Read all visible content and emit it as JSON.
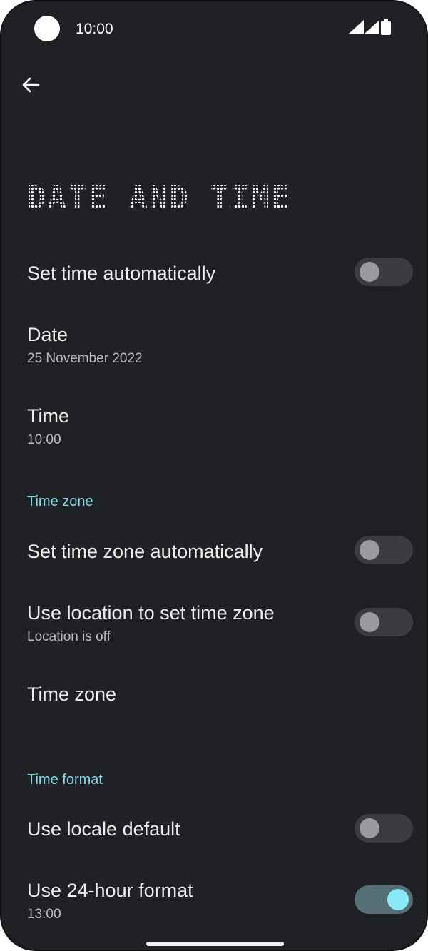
{
  "status_bar": {
    "time": "10:00"
  },
  "page": {
    "title": "DATE AND TIME"
  },
  "rows": {
    "set_time_auto": {
      "label": "Set time automatically",
      "toggle_on": false
    },
    "date": {
      "label": "Date",
      "value": "25 November 2022"
    },
    "time": {
      "label": "Time",
      "value": "10:00"
    },
    "set_zone_auto": {
      "label": "Set time zone automatically",
      "toggle_on": false
    },
    "use_location": {
      "label": "Use location to set time zone",
      "subtitle": "Location is off",
      "toggle_on": false
    },
    "time_zone": {
      "label": "Time zone"
    },
    "locale_default": {
      "label": "Use locale default",
      "toggle_on": false
    },
    "format_24h": {
      "label": "Use 24-hour format",
      "value": "13:00",
      "toggle_on": true
    }
  },
  "sections": {
    "time_zone": "Time zone",
    "time_format": "Time format"
  },
  "colors": {
    "background": "#202124",
    "accent": "#7fdbea",
    "toggle_on_track": "#577078",
    "toggle_on_knob": "#87eaf6"
  },
  "icons": {
    "back": "arrow-back-icon",
    "signal": "signal-icon",
    "battery": "battery-icon"
  }
}
